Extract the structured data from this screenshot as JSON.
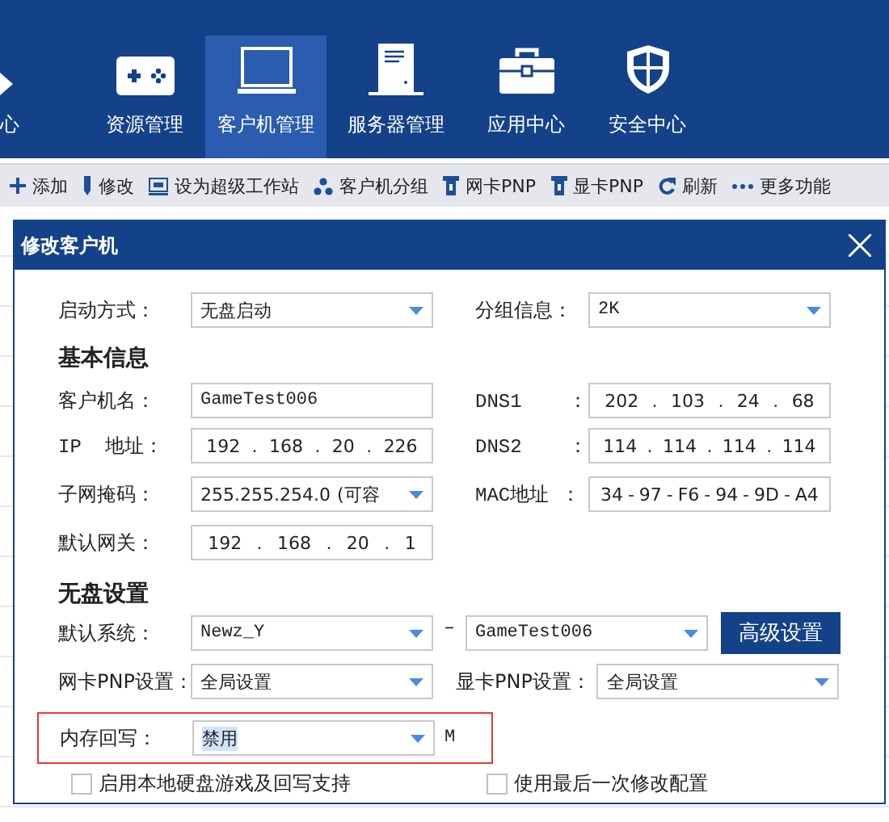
{
  "nav": {
    "items": [
      {
        "label": "心",
        "selected": false
      },
      {
        "label": "资源管理",
        "selected": false
      },
      {
        "label": "客户机管理",
        "selected": true
      },
      {
        "label": "服务器管理",
        "selected": false
      },
      {
        "label": "应用中心",
        "selected": false
      },
      {
        "label": "安全中心",
        "selected": false
      }
    ]
  },
  "toolbar": {
    "items": [
      "添加",
      "修改",
      "设为超级工作站",
      "客户机分组",
      "网卡PNP",
      "显卡PNP",
      "刷新",
      "更多功能"
    ]
  },
  "dialog": {
    "title": "修改客户机",
    "boot_mode": {
      "label": "启动方式：",
      "value": "无盘启动"
    },
    "group": {
      "label": "分组信息：",
      "value": "2K"
    },
    "section_basic": "基本信息",
    "client_name": {
      "label": "客户机名：",
      "value": "GameTest006"
    },
    "dns1": {
      "label": "DNS1    ：",
      "parts": [
        "202",
        "103",
        "24",
        "68"
      ],
      "separator": "."
    },
    "ip": {
      "label": "IP  地址：",
      "parts": [
        "192",
        "168",
        "20",
        "226"
      ],
      "separator": "."
    },
    "dns2": {
      "label": "DNS2    ：",
      "parts": [
        "114",
        "114",
        "114",
        "114"
      ],
      "separator": "."
    },
    "subnet": {
      "label": "子网掩码：",
      "value": "255.255.254.0",
      "note": "(可容"
    },
    "mac": {
      "label": "MAC地址 ：",
      "parts": [
        "34",
        "97",
        "F6",
        "94",
        "9D",
        "A4"
      ],
      "separator": "-"
    },
    "gateway": {
      "label": "默认网关：",
      "parts": [
        "192",
        "168",
        "20",
        "1"
      ],
      "separator": "."
    },
    "section_diskless": "无盘设置",
    "default_system": {
      "label": "默认系统：",
      "value": "Newz_Y",
      "dash": "–",
      "value2": "GameTest006",
      "button": "高级设置"
    },
    "nic_pnp": {
      "label": "网卡PNP设置：",
      "value": "全局设置"
    },
    "gpu_pnp": {
      "label": "显卡PNP设置：",
      "value": "全局设置"
    },
    "mem_writeback": {
      "label": "内存回写：",
      "value": "禁用",
      "unit": "M",
      "highlighted": true
    },
    "checkboxes": [
      {
        "label": "启用本地硬盘游戏及回写支持",
        "checked": false
      },
      {
        "label": "使用最后一次修改配置",
        "checked": false
      }
    ]
  }
}
